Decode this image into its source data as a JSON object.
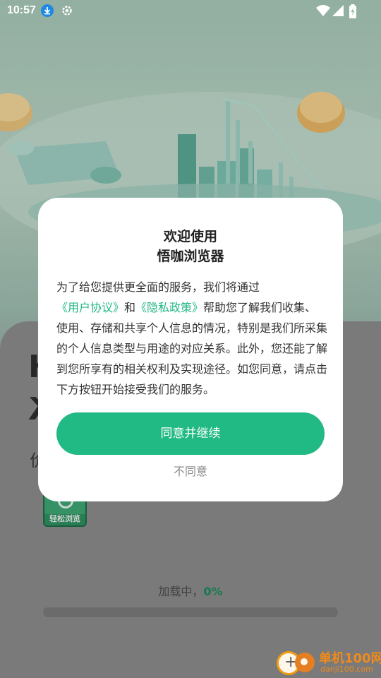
{
  "status_bar": {
    "time": "10:57"
  },
  "background": {
    "big_char_1": "Н",
    "big_char_2": "Ж",
    "sub_char": "价",
    "app_logo_text": "轻松浏览"
  },
  "loading": {
    "label": "加载中，",
    "percent": "0%",
    "progress": 0
  },
  "dialog": {
    "title_line1": "欢迎使用",
    "title_line2": "悟咖浏览器",
    "body_part1": "为了给您提供更全面的服务，我们将通过",
    "user_agreement_link": "《用户协议》",
    "body_part2": "和",
    "privacy_policy_link": "《隐私政策》",
    "body_part3": "帮助您了解我们收集、使用、存储和共享个人信息的情况，特别是我们所采集的个人信息类型与用途的对应关系。此外，您还能了解到您所享有的相关权利及实现途径。如您同意，请点击下方按钮开始接受我们的服务。",
    "agree_label": "同意并继续",
    "disagree_label": "不同意"
  },
  "watermark": {
    "title": "单机100网",
    "url": "danji100.com"
  },
  "colors": {
    "accent": "#21b984",
    "link": "#22b783",
    "watermark": "#f08a1c"
  }
}
